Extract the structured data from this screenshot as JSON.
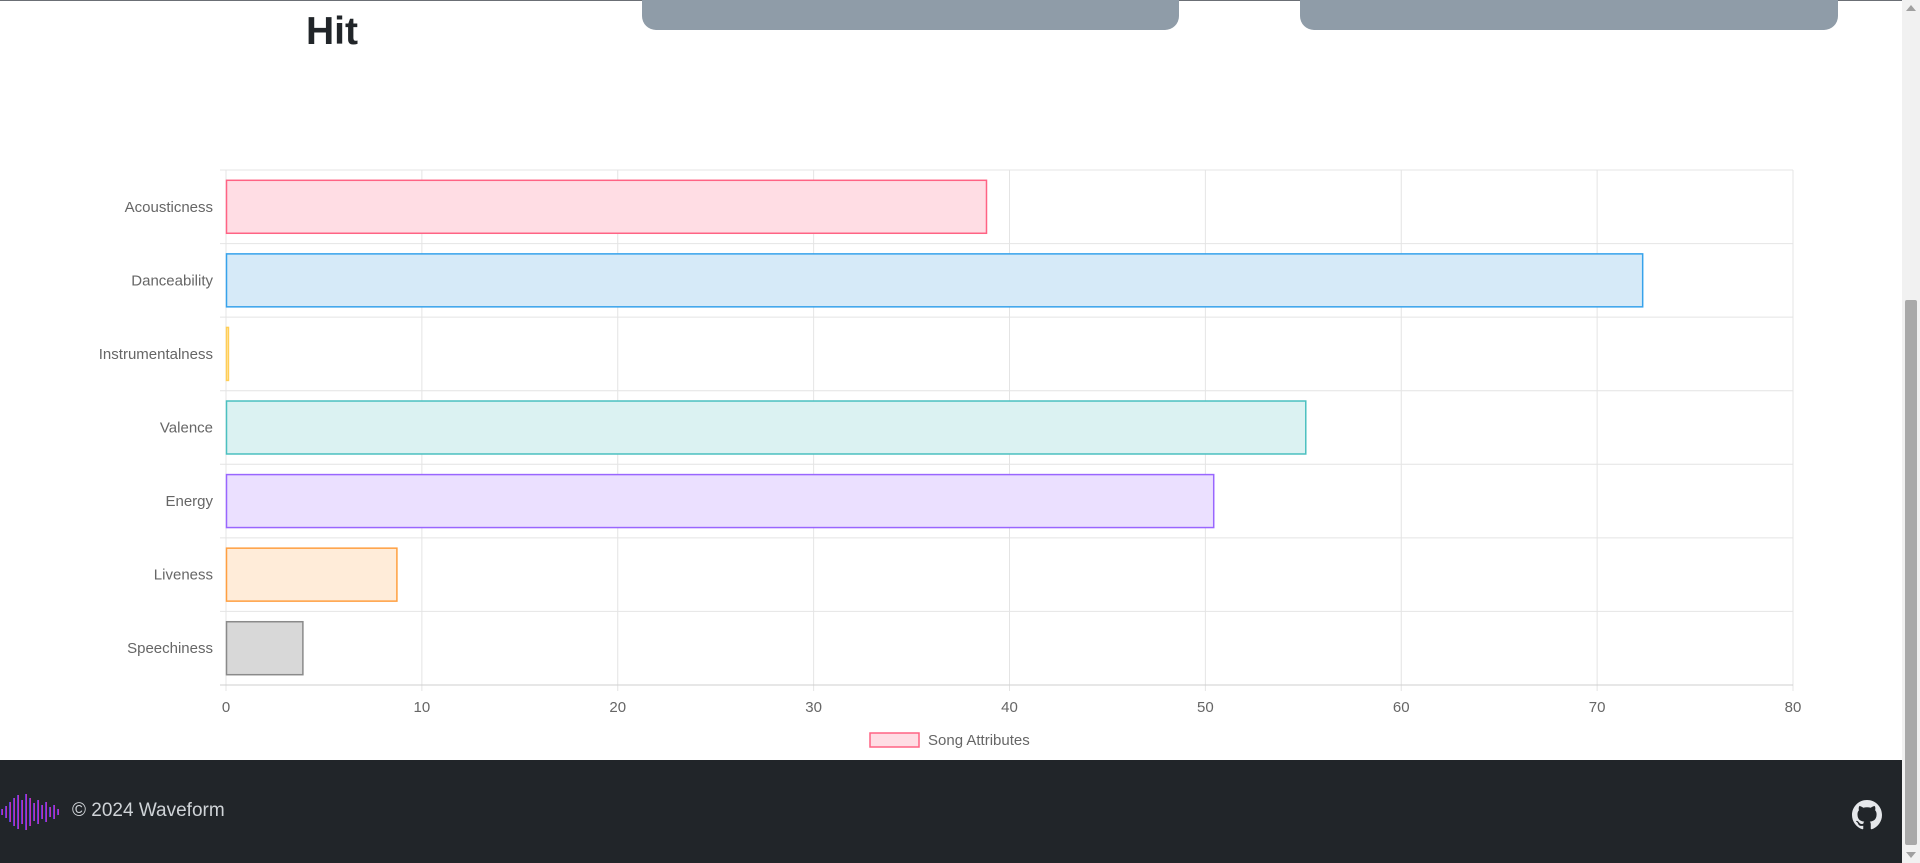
{
  "header": {
    "title_line2": "Hit"
  },
  "chart_data": {
    "type": "bar",
    "orientation": "horizontal",
    "categories": [
      "Acousticness",
      "Danceability",
      "Instrumentalness",
      "Valence",
      "Energy",
      "Liveness",
      "Speechiness"
    ],
    "series": [
      {
        "name": "Song Attributes",
        "values": [
          38.8,
          72.3,
          0.1,
          55.1,
          50.4,
          8.7,
          3.9
        ]
      }
    ],
    "bar_colors": [
      {
        "fill": "#ffdde4",
        "stroke": "#ff6384"
      },
      {
        "fill": "#d6eaf8",
        "stroke": "#36a2eb"
      },
      {
        "fill": "#fff2d9",
        "stroke": "#ffce56"
      },
      {
        "fill": "#dbf2f2",
        "stroke": "#4bc0c0"
      },
      {
        "fill": "#ebe0ff",
        "stroke": "#9966ff"
      },
      {
        "fill": "#ffecd9",
        "stroke": "#ff9f40"
      },
      {
        "fill": "#d8d8d8",
        "stroke": "#8a8a8a"
      }
    ],
    "xlim": [
      0,
      80
    ],
    "xticks": [
      0,
      10,
      20,
      30,
      40,
      50,
      60,
      70,
      80
    ],
    "grid": true,
    "legend_position": "bottom",
    "title": "",
    "xlabel": "",
    "ylabel": ""
  },
  "footer": {
    "copyright": "© 2024 Waveform",
    "logo_icon": "waveform-logo-icon",
    "github_icon": "github-icon",
    "background": "#212529"
  }
}
